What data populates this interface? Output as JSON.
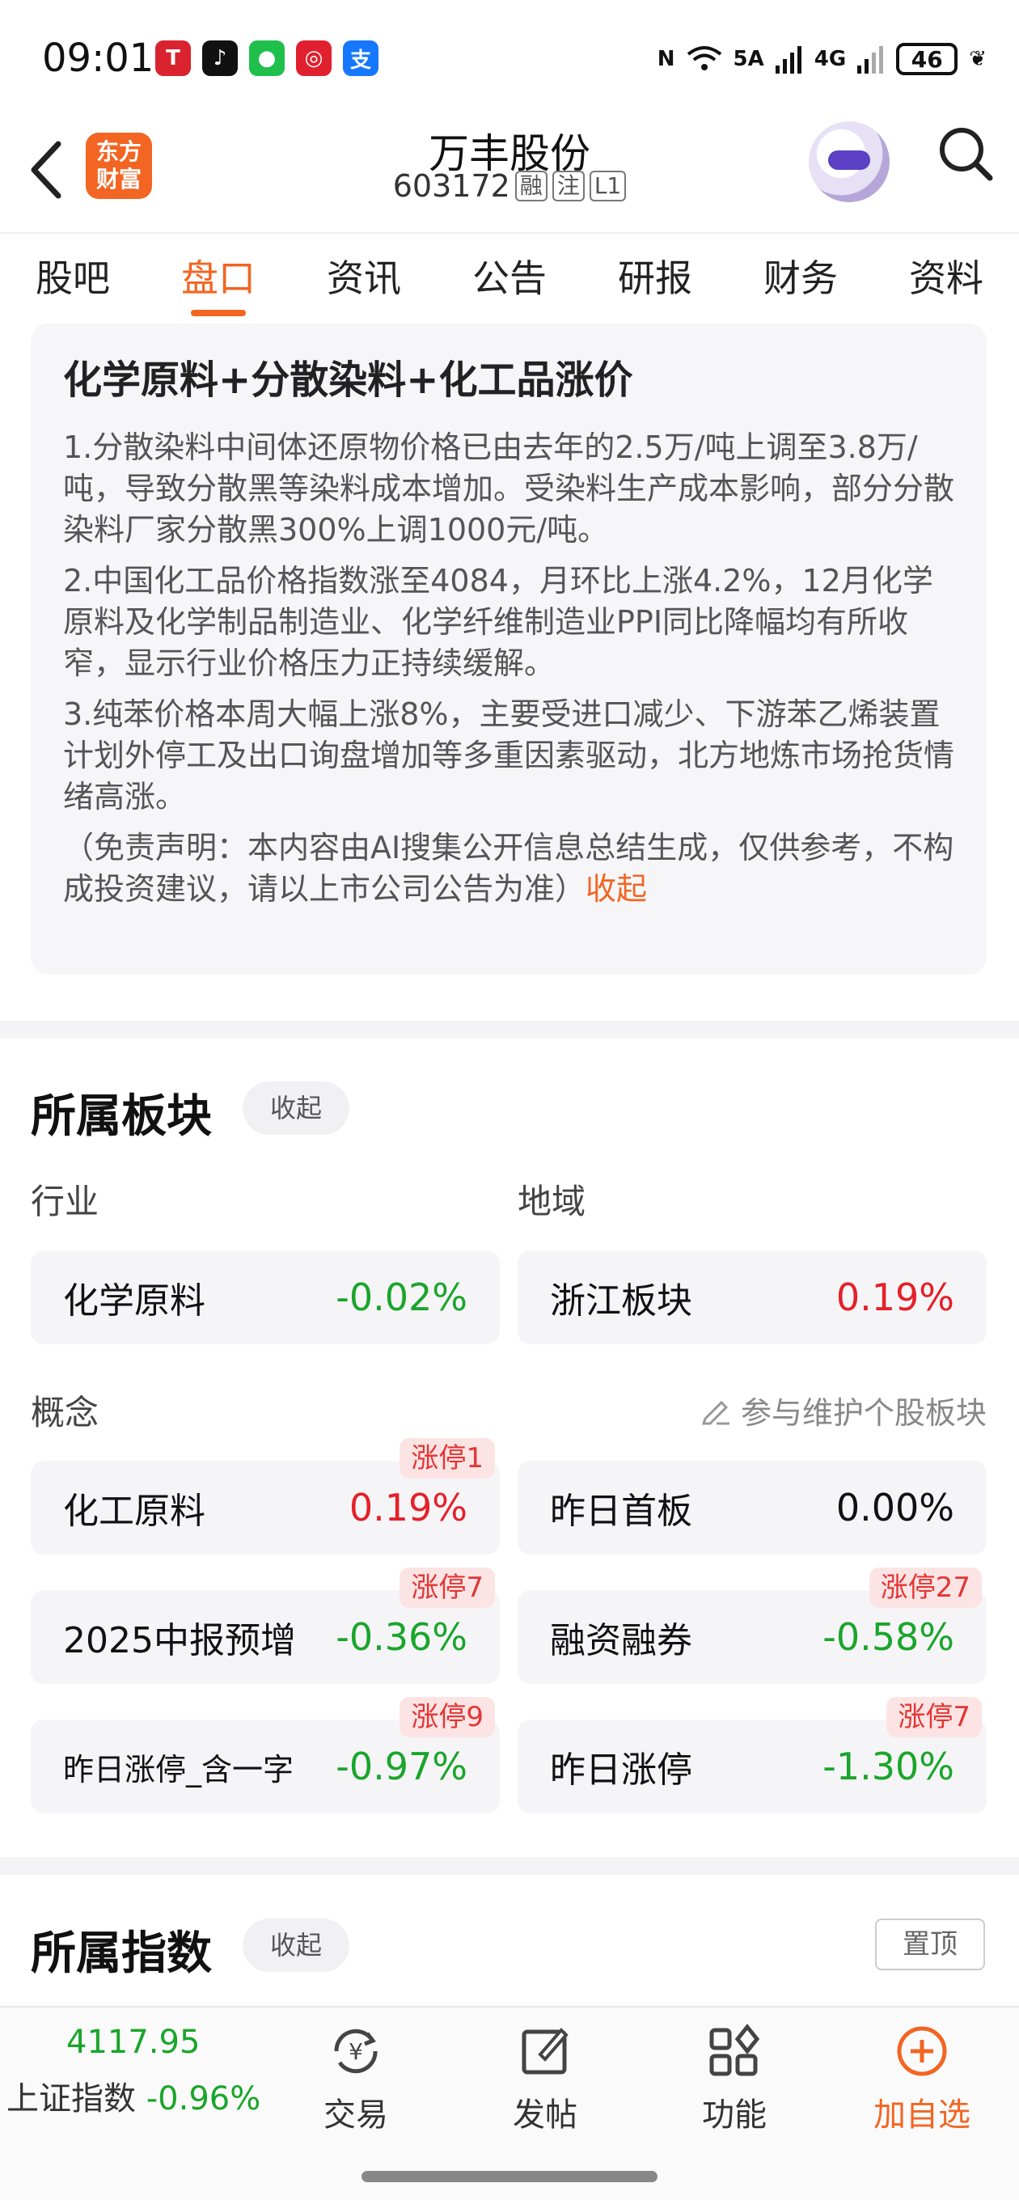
{
  "status_bar": {
    "time": "09:01",
    "battery": "46",
    "signal_labels": [
      "5A",
      "4G"
    ]
  },
  "header": {
    "logo_line1": "东方",
    "logo_line2": "财富",
    "stock_name": "万丰股份",
    "stock_code": "603172",
    "tags": [
      "融",
      "注",
      "L1"
    ]
  },
  "tabs": [
    "股吧",
    "盘口",
    "资讯",
    "公告",
    "研报",
    "财务",
    "资料"
  ],
  "active_tab": "盘口",
  "summary": {
    "title": "化学原料+分散染料+化工品涨价",
    "p1": "1.分散染料中间体还原物价格已由去年的2.5万/吨上调至3.8万/吨，导致分散黑等染料成本增加。受染料生产成本影响，部分分散染料厂家分散黑300%上调1000元/吨。",
    "p2": "2.中国化工品价格指数涨至4084，月环比上涨4.2%，12月化学原料及化学制品制造业、化学纤维制造业PPI同比降幅均有所收窄，显示行业价格压力正持续缓解。",
    "p3": "3.纯苯价格本周大幅上涨8%，主要受进口减少、下游苯乙烯装置计划外停工及出口询盘增加等多重因素驱动，北方地炼市场抢货情绪高涨。",
    "disclaimer": "（免责声明：本内容由AI搜集公开信息总结生成，仅供参考，不构成投资建议，请以上市公司公告为准）",
    "collapse": "收起"
  },
  "sectors": {
    "title": "所属板块",
    "collapse": "收起",
    "industry_label": "行业",
    "region_label": "地域",
    "concept_label": "概念",
    "maintain_link": "参与维护个股板块",
    "industry": {
      "name": "化学原料",
      "change": "-0.02%"
    },
    "region": {
      "name": "浙江板块",
      "change": "0.19%"
    },
    "concepts": [
      {
        "name": "化工原料",
        "change": "0.19%",
        "badge": "涨停1",
        "dir": "up"
      },
      {
        "name": "昨日首板",
        "change": "0.00%",
        "badge": "",
        "dir": "flat"
      },
      {
        "name": "2025中报预增",
        "change": "-0.36%",
        "badge": "涨停7",
        "dir": "down"
      },
      {
        "name": "融资融券",
        "change": "-0.58%",
        "badge": "涨停27",
        "dir": "down"
      },
      {
        "name": "昨日涨停_含一字",
        "change": "-0.97%",
        "badge": "涨停9",
        "dir": "down"
      },
      {
        "name": "昨日涨停",
        "change": "-1.30%",
        "badge": "涨停7",
        "dir": "down"
      }
    ]
  },
  "indices": {
    "title": "所属指数",
    "collapse": "收起",
    "pin": "置顶"
  },
  "bottom_bar": {
    "index_value": "4117.95",
    "index_name": "上证指数",
    "index_change": "-0.96%",
    "trade": "交易",
    "post": "发帖",
    "functions": "功能",
    "add_watch": "加自选"
  },
  "colors": {
    "accent": "#f26522",
    "up": "#e5202a",
    "down": "#1aa52b"
  }
}
